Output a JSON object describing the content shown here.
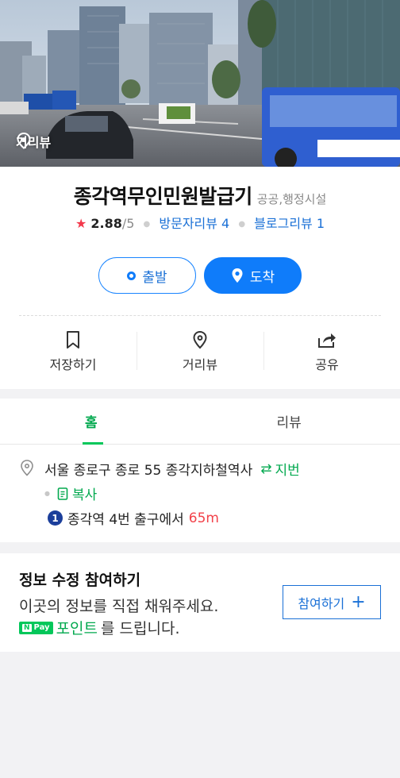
{
  "photo": {
    "street_view_label": "거리뷰"
  },
  "place": {
    "name": "종각역무인민원발급기",
    "category": "공공,행정시설",
    "rating": "2.88",
    "rating_max": "/5",
    "visitor_reviews": "방문자리뷰 4",
    "blog_reviews": "블로그리뷰 1"
  },
  "route": {
    "depart_label": "출발",
    "arrive_label": "도착"
  },
  "actions": {
    "save_label": "저장하기",
    "street_view_label": "거리뷰",
    "share_label": "공유"
  },
  "tabs": [
    {
      "label": "홈",
      "active": true
    },
    {
      "label": "리뷰",
      "active": false
    }
  ],
  "address": {
    "road": "서울 종로구 종로 55 종각지하철역사",
    "jibun_label": "지번",
    "copy_label": "복사",
    "subway_line": "1",
    "exit_text": "종각역 4번 출구에서",
    "distance": "65m"
  },
  "join": {
    "title": "정보 수정 참여하기",
    "desc": "이곳의 정보를 직접 채워주세요.",
    "npay_n": "N",
    "npay_text": "Pay",
    "point_word": "포인트",
    "point_suffix": "를 드립니다.",
    "button_label": "참여하기"
  },
  "colors": {
    "primary_blue": "#0f7cfa",
    "naver_green": "#03c75a",
    "star_red": "#f3384b",
    "subway_line1": "#1b3e9b"
  }
}
